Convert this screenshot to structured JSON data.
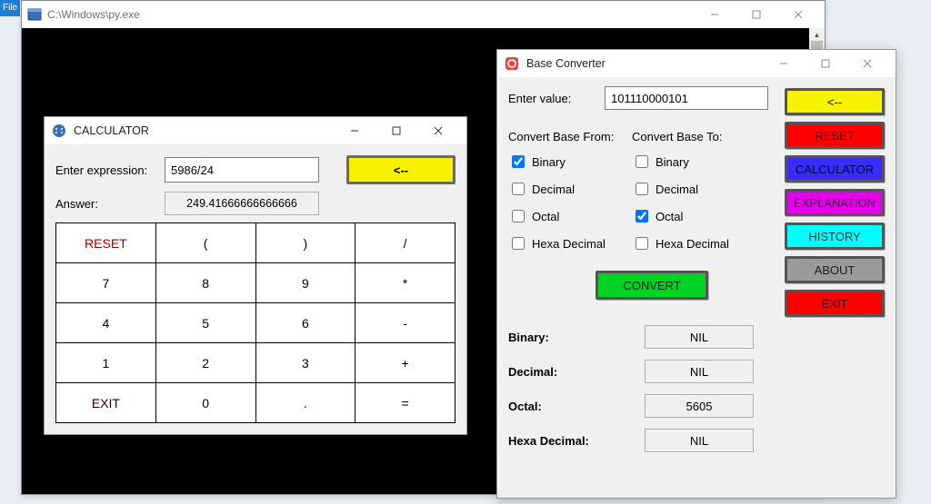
{
  "edge_tab": "File",
  "console": {
    "title": "C:\\Windows\\py.exe"
  },
  "calc": {
    "title": "CALCULATOR",
    "expr_label": "Enter expression:",
    "expr_value": "5986/24",
    "answer_label": "Answer:",
    "answer_value": "249.41666666666666",
    "backspace": "<--",
    "keys": {
      "reset": "RESET",
      "lp": "(",
      "rp": ")",
      "div": "/",
      "k7": "7",
      "k8": "8",
      "k9": "9",
      "mul": "*",
      "k4": "4",
      "k5": "5",
      "k6": "6",
      "sub": "-",
      "k1": "1",
      "k2": "2",
      "k3": "3",
      "add": "+",
      "exit": "EXIT",
      "k0": "0",
      "dot": ".",
      "eq": "="
    }
  },
  "conv": {
    "title": "Base Converter",
    "enter_label": "Enter value:",
    "enter_value": "101110000101",
    "from_header": "Convert Base From:",
    "to_header": "Convert Base To:",
    "opt_binary": "Binary",
    "opt_decimal": "Decimal",
    "opt_octal": "Octal",
    "opt_hex": "Hexa Decimal",
    "from_checked": {
      "binary": true,
      "decimal": false,
      "octal": false,
      "hex": false
    },
    "to_checked": {
      "binary": false,
      "decimal": false,
      "octal": true,
      "hex": false
    },
    "convert_label": "CONVERT",
    "side": {
      "back": "<--",
      "reset": "RESET",
      "calculator": "CALCULATOR",
      "explanation": "EXPLANATION",
      "history": "HISTORY",
      "about": "ABOUT",
      "exit": "EXIT"
    },
    "results": {
      "binary_label": "Binary:",
      "binary_value": "NIL",
      "decimal_label": "Decimal:",
      "decimal_value": "NIL",
      "octal_label": "Octal:",
      "octal_value": "5605",
      "hex_label": "Hexa Decimal:",
      "hex_value": "NIL"
    }
  }
}
